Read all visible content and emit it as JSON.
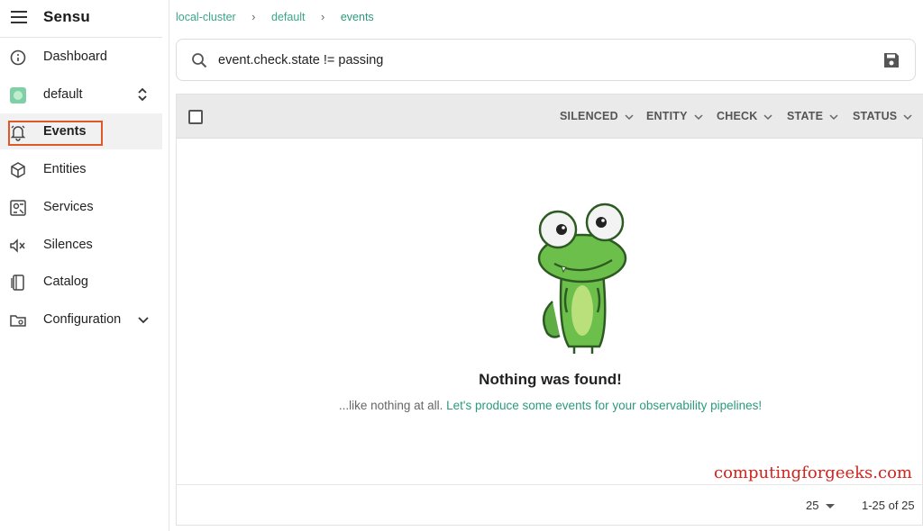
{
  "app": {
    "name": "Sensu"
  },
  "sidebar": {
    "items": [
      {
        "label": "Dashboard",
        "icon": "dashboard-icon"
      },
      {
        "label": "default",
        "icon": "namespace-icon"
      },
      {
        "label": "Events",
        "icon": "bell-icon"
      },
      {
        "label": "Entities",
        "icon": "cube-icon"
      },
      {
        "label": "Services",
        "icon": "services-icon"
      },
      {
        "label": "Silences",
        "icon": "volume-mute-icon"
      },
      {
        "label": "Catalog",
        "icon": "catalog-icon"
      },
      {
        "label": "Configuration",
        "icon": "folder-settings-icon"
      }
    ]
  },
  "breadcrumb": {
    "cluster": "local-cluster",
    "namespace": "default",
    "current": "events"
  },
  "search": {
    "query": "event.check.state != passing"
  },
  "table": {
    "columns": [
      "SILENCED",
      "ENTITY",
      "CHECK",
      "STATE",
      "STATUS"
    ]
  },
  "empty_state": {
    "title": "Nothing was found!",
    "text": "...like nothing at all.",
    "link": "Let's produce some events for your observability pipelines!"
  },
  "pagination": {
    "per_page": "25",
    "range": "1-25 of 25"
  },
  "watermark": "computingforgeeks.com",
  "colors": {
    "accent": "#2b9a7c",
    "highlight": "#e0572a",
    "watermark": "#d4231f"
  }
}
